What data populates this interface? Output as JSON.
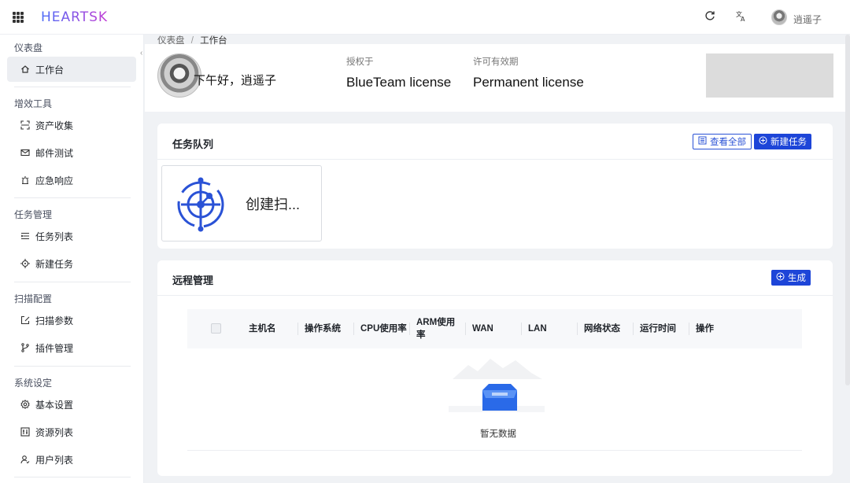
{
  "header": {
    "logo": "HEARTSK",
    "refresh_icon": "refresh-icon",
    "translate_icon": "translate-icon",
    "username": "逍遥子"
  },
  "sidebar": {
    "groups": [
      {
        "title": "仪表盘",
        "items": [
          {
            "label": "工作台",
            "icon": "home-icon",
            "active": true
          }
        ]
      },
      {
        "title": "增效工具",
        "items": [
          {
            "label": "资产收集",
            "icon": "scan-icon"
          },
          {
            "label": "邮件测试",
            "icon": "mail-icon"
          },
          {
            "label": "应急响应",
            "icon": "alarm-icon"
          }
        ]
      },
      {
        "title": "任务管理",
        "items": [
          {
            "label": "任务列表",
            "icon": "list-icon"
          },
          {
            "label": "新建任务",
            "icon": "target-icon"
          }
        ]
      },
      {
        "title": "扫描配置",
        "items": [
          {
            "label": "扫描参数",
            "icon": "edit-icon"
          },
          {
            "label": "插件管理",
            "icon": "branch-icon"
          }
        ]
      },
      {
        "title": "系统设定",
        "items": [
          {
            "label": "基本设置",
            "icon": "gear-icon"
          },
          {
            "label": "资源列表",
            "icon": "resource-icon"
          },
          {
            "label": "用户列表",
            "icon": "user-icon"
          }
        ]
      }
    ]
  },
  "breadcrumb": {
    "root": "仪表盘",
    "sep": "/",
    "current": "工作台"
  },
  "profile": {
    "greeting": "下午好，逍遥子",
    "licensed_to_label": "授权于",
    "licensed_to_value": "BlueTeam license",
    "validity_label": "许可有效期",
    "validity_value": "Permanent license"
  },
  "task_queue": {
    "title": "任务队列",
    "view_all": "查看全部",
    "new_task": "新建任务",
    "tile_label": "创建扫..."
  },
  "remote": {
    "title": "远程管理",
    "generate": "生成",
    "columns": [
      "主机名",
      "操作系统",
      "CPU使用率",
      "ARM使用率",
      "WAN",
      "LAN",
      "网络状态",
      "运行时间",
      "操作"
    ],
    "empty_text": "暂无数据"
  },
  "colors": {
    "primary": "#1d45d8",
    "active_bg": "#eceef2",
    "bg": "#f0f2f5"
  }
}
